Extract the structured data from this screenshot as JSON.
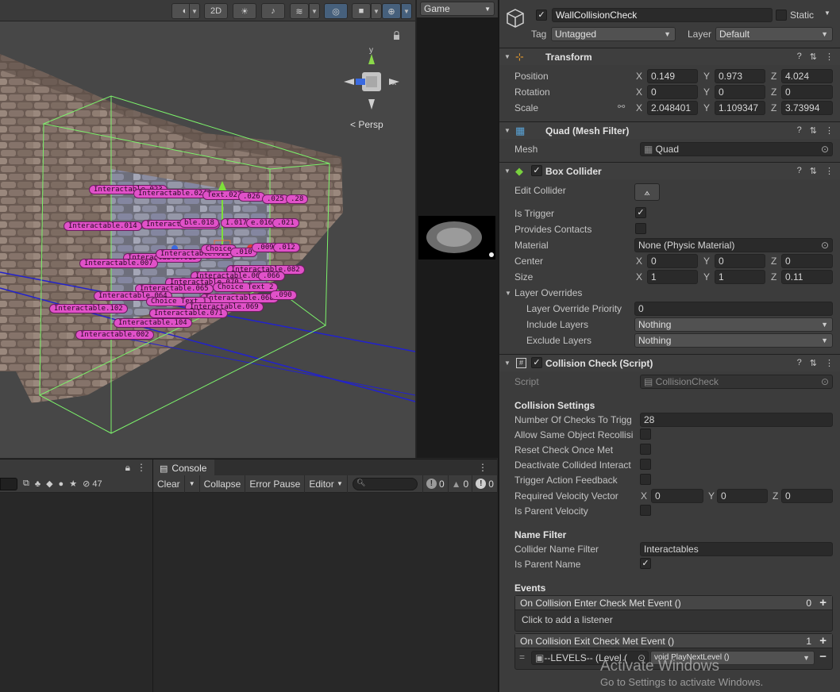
{
  "scene": {
    "toolbar": {
      "btn_2d": "2D",
      "game_tab": "Game"
    },
    "persp_label": "< Persp",
    "labels": [
      "Interactable.023",
      "Interactable.024",
      "Text.027",
      ".026",
      ".025",
      ".28",
      "Interactable.014",
      "Interactable.015",
      "ble.018",
      "I.017",
      "e.016",
      ".021",
      "Interactable.013",
      "Interactable.011",
      "Choice",
      ".010",
      ".009",
      ".012",
      "Interactable.007",
      "Interactable.082",
      "Interactable.067",
      ".066",
      "Interactable.070",
      "Interactable.065",
      "Choice Text 2",
      "Interactable.064",
      "Interactable.068",
      ".090",
      "Choice Text 1",
      "Interactable.102",
      "Interactable.069",
      "Interactable.071",
      "Interactable.104",
      "Interactable.002"
    ]
  },
  "project": {
    "hidden_count": "47"
  },
  "console": {
    "tab": "Console",
    "clear": "Clear",
    "collapse": "Collapse",
    "error_pause": "Error Pause",
    "editor": "Editor",
    "count_info": "0",
    "count_warn": "0",
    "count_error": "0"
  },
  "inspector": {
    "object_name": "WallCollisionCheck",
    "static_label": "Static",
    "tag_label": "Tag",
    "tag_value": "Untagged",
    "layer_label": "Layer",
    "layer_value": "Default",
    "transform": {
      "title": "Transform",
      "position_label": "Position",
      "pos": [
        "0.149",
        "0.973",
        "4.024"
      ],
      "rotation_label": "Rotation",
      "rot": [
        "0",
        "0",
        "0"
      ],
      "scale_label": "Scale",
      "scale": [
        "2.048401",
        "1.109347",
        "3.73994"
      ]
    },
    "mesh_filter": {
      "title": "Quad (Mesh Filter)",
      "mesh_label": "Mesh",
      "mesh_value": "Quad"
    },
    "box_collider": {
      "title": "Box Collider",
      "edit_collider": "Edit Collider",
      "is_trigger": "Is Trigger",
      "provides_contacts": "Provides Contacts",
      "material_label": "Material",
      "material_value": "None (Physic Material)",
      "center_label": "Center",
      "center": [
        "0",
        "0",
        "0"
      ],
      "size_label": "Size",
      "size": [
        "1",
        "1",
        "0.11"
      ],
      "layer_overrides": "Layer Overrides",
      "override_priority_label": "Layer Override Priority",
      "override_priority": "0",
      "include_label": "Include Layers",
      "include_value": "Nothing",
      "exclude_label": "Exclude Layers",
      "exclude_value": "Nothing"
    },
    "script": {
      "title": "Collision Check (Script)",
      "script_label": "Script",
      "script_value": "CollisionCheck",
      "settings_title": "Collision Settings",
      "num_checks_label": "Number Of Checks To Trigg",
      "num_checks": "28",
      "allow_same_label": "Allow Same Object Recollisi",
      "reset_label": "Reset Check Once Met",
      "deactivate_label": "Deactivate Collided Interact",
      "trigger_feedback_label": "Trigger Action Feedback",
      "velocity_label": "Required Velocity Vector",
      "velocity": [
        "0",
        "0",
        "0"
      ],
      "parent_velocity_label": "Is Parent Velocity",
      "name_filter_title": "Name Filter",
      "collider_name_label": "Collider Name Filter",
      "collider_name": "Interactables",
      "parent_name_label": "Is Parent Name",
      "events_title": "Events",
      "enter_event": "On Collision Enter Check Met Event ()",
      "enter_count": "0",
      "add_listener": "Click to add a listener",
      "exit_event": "On Collision Exit Check Met Event ()",
      "exit_count": "1",
      "listener_object": "--LEVELS-- (Level (",
      "listener_func": "void PlayNextLevel ()"
    }
  },
  "watermark": {
    "line1": "Activate Windows",
    "line2": "Go to Settings to activate Windows."
  }
}
